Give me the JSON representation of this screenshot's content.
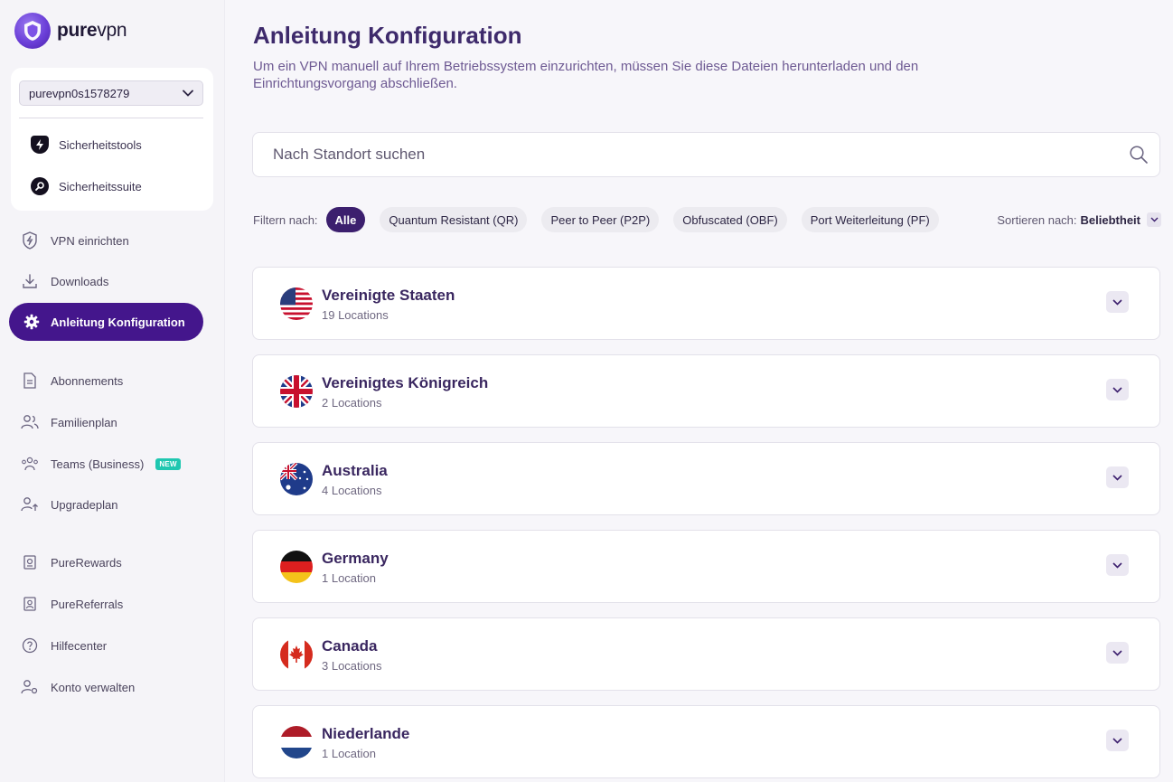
{
  "brand": {
    "name_bold": "pure",
    "name_light": "vpn"
  },
  "account": {
    "username": "purevpn0s1578279",
    "items": [
      {
        "label": "Sicherheitstools",
        "icon": "shield-bolt-icon"
      },
      {
        "label": "Sicherheitssuite",
        "icon": "search-shield-icon"
      }
    ]
  },
  "nav": {
    "setup_vpn": "VPN einrichten",
    "downloads": "Downloads",
    "manual_config": "Anleitung Konfiguration",
    "subscriptions": "Abonnements",
    "family_plan": "Familienplan",
    "teams": "Teams (Business)",
    "teams_badge": "NEW",
    "upgrade": "Upgradeplan",
    "rewards": "PureRewards",
    "referrals": "PureReferrals",
    "help": "Hilfecenter",
    "account": "Konto verwalten"
  },
  "main": {
    "title": "Anleitung Konfiguration",
    "subtitle": "Um ein VPN manuell auf Ihrem Betriebssystem einzurichten, müssen Sie diese Dateien herunterladen und den Einrichtungsvorgang abschließen.",
    "search_placeholder": "Nach Standort suchen",
    "filter_label": "Filtern nach:",
    "filters": [
      "Alle",
      "Quantum Resistant (QR)",
      "Peer to Peer (P2P)",
      "Obfuscated (OBF)",
      "Port Weiterleitung (PF)"
    ],
    "active_filter": "Alle",
    "sort_label": "Sortieren nach:",
    "sort_value": "Beliebtheit"
  },
  "countries": [
    {
      "name": "Vereinigte Staaten",
      "locations": "19 Locations",
      "flag": "us-flag-icon"
    },
    {
      "name": "Vereinigtes Königreich",
      "locations": "2 Locations",
      "flag": "uk-flag-icon"
    },
    {
      "name": "Australia",
      "locations": "4 Locations",
      "flag": "au-flag-icon"
    },
    {
      "name": "Germany",
      "locations": "1 Location",
      "flag": "de-flag-icon"
    },
    {
      "name": "Canada",
      "locations": "3 Locations",
      "flag": "ca-flag-icon"
    },
    {
      "name": "Niederlande",
      "locations": "1 Location",
      "flag": "nl-flag-icon"
    }
  ],
  "colors": {
    "accent": "#44168c",
    "title": "#3e2a6b",
    "badge": "#1fc7b0"
  }
}
